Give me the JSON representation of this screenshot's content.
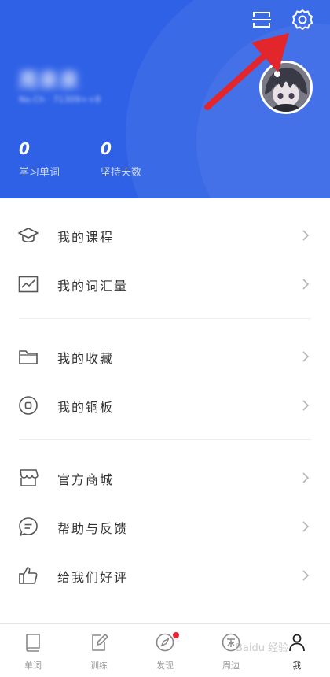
{
  "colors": {
    "header_bg": "#2f61e6",
    "annotation_arrow": "#e3262b",
    "badge_red": "#ee2233",
    "text_primary": "#333333",
    "text_secondary": "#999999"
  },
  "header": {
    "username": "周泉泉",
    "user_sub": "No.Ch · 71309++8",
    "stats": [
      {
        "value": "0",
        "label": "学习单词"
      },
      {
        "value": "0",
        "label": "坚持天数"
      }
    ],
    "icons": {
      "scan": "scan-icon",
      "settings": "gear-icon",
      "avatar": "anime-avatar"
    }
  },
  "menu": {
    "items": [
      {
        "label": "我的课程",
        "icon": "graduation-cap-icon"
      },
      {
        "label": "我的词汇量",
        "icon": "trend-chart-icon"
      },
      {
        "label": "我的收藏",
        "icon": "folder-icon"
      },
      {
        "label": "我的铜板",
        "icon": "coin-icon"
      },
      {
        "label": "官方商城",
        "icon": "shop-icon"
      },
      {
        "label": "帮助与反馈",
        "icon": "chat-bubble-icon"
      },
      {
        "label": "给我们好评",
        "icon": "thumbs-up-icon"
      }
    ]
  },
  "bottom_nav": {
    "items": [
      {
        "label": "单词",
        "icon": "book-icon"
      },
      {
        "label": "训练",
        "icon": "edit-icon"
      },
      {
        "label": "发现",
        "icon": "compass-icon"
      },
      {
        "label": "周边",
        "icon": "taobao-icon"
      },
      {
        "label": "我",
        "icon": "person-icon"
      }
    ],
    "active_index": 4
  },
  "watermark": "Baidu 经验"
}
